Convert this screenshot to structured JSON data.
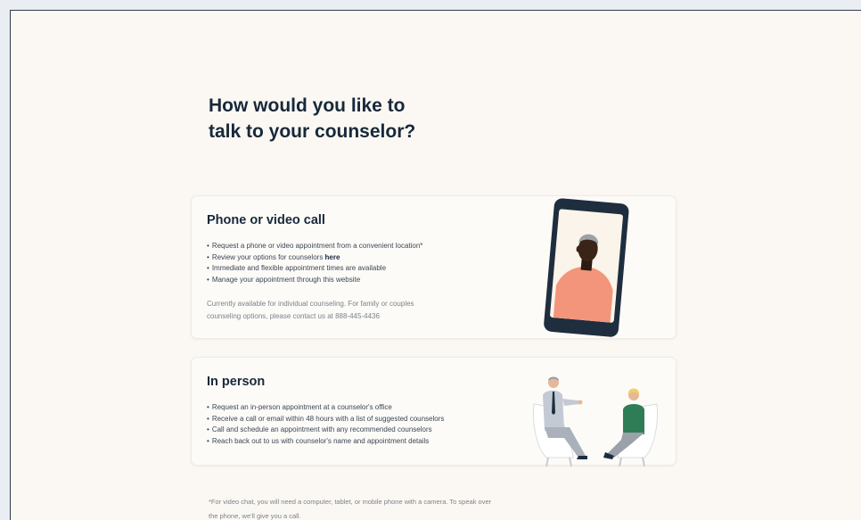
{
  "page": {
    "headline_line1": "How would you like to",
    "headline_line2": "talk to your counselor?"
  },
  "phone_option": {
    "title": "Phone or video call",
    "bullets": [
      "Request a phone or video appointment from a convenient location*",
      "Review your options for counselors ",
      "Immediate and flexible appointment times are available",
      "Manage your appointment through this website"
    ],
    "review_link": "here",
    "availability_line1": "Currently available for individual counseling. For family or couples",
    "availability_line2": "counseling options, please contact us at 888-445-4436",
    "illustration_icon": "phone-video-call-illustration"
  },
  "in_person_option": {
    "title": "In person",
    "bullets": [
      "Request an in-person appointment at a counselor's office",
      "Receive a call or email within 48 hours with a list of suggested counselors",
      "Call and schedule an appointment with any recommended counselors",
      "Reach back out to us with counselor's name and appointment details"
    ],
    "illustration_icon": "counseling-session-illustration"
  },
  "footnote": {
    "line1": "*For video chat, you will need a computer, tablet, or mobile phone with a camera. To speak over",
    "line2": "the phone, we'll give you a call."
  },
  "colors": {
    "background": "#fbf8f3",
    "heading": "#18283a",
    "phone_dark": "#1e2e3e",
    "accent_salmon": "#f3957a",
    "accent_green": "#2f7d56"
  }
}
